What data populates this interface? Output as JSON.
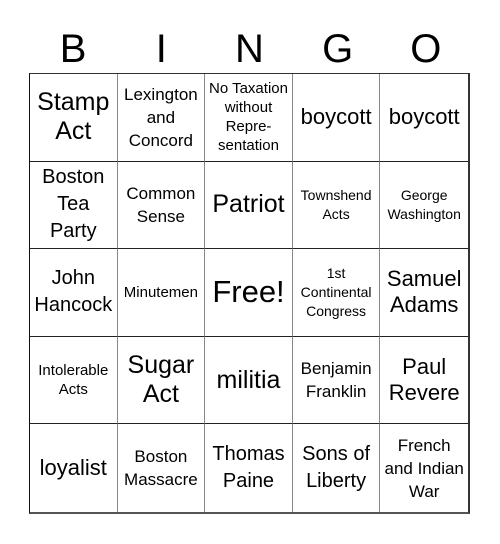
{
  "title_letters": [
    "B",
    "I",
    "N",
    "G",
    "O"
  ],
  "colors": {
    "text": "#000000",
    "background": "#ffffff",
    "grid_line": "#222222",
    "vertical_line": "#888888"
  },
  "cells": [
    {
      "text": "Stamp\nAct",
      "size": "s-l"
    },
    {
      "text": "Lexington\nand\nConcord",
      "size": "s-s"
    },
    {
      "text": "No Taxation\nwithout\nRepre-\nsentation",
      "size": "s-xs"
    },
    {
      "text": "boycott",
      "size": "s-ml"
    },
    {
      "text": "boycott",
      "size": "s-ml"
    },
    {
      "text": "Boston\nTea\nParty",
      "size": "s-m"
    },
    {
      "text": "Common\nSense",
      "size": "s-s"
    },
    {
      "text": "Patriot",
      "size": "s-l"
    },
    {
      "text": "Townshend\nActs",
      "size": "s-xxs"
    },
    {
      "text": "George\nWashington",
      "size": "s-xxs"
    },
    {
      "text": "John\nHancock",
      "size": "s-m"
    },
    {
      "text": "Minutemen",
      "size": "s-xs"
    },
    {
      "text": "Free!",
      "size": "s-xl"
    },
    {
      "text": "1st\nContinental\nCongress",
      "size": "s-xxs"
    },
    {
      "text": "Samuel\nAdams",
      "size": "s-ml"
    },
    {
      "text": "Intolerable\nActs",
      "size": "s-xs"
    },
    {
      "text": "Sugar\nAct",
      "size": "s-l"
    },
    {
      "text": "militia",
      "size": "s-l"
    },
    {
      "text": "Benjamin\nFranklin",
      "size": "s-s"
    },
    {
      "text": "Paul\nRevere",
      "size": "s-ml"
    },
    {
      "text": "loyalist",
      "size": "s-ml"
    },
    {
      "text": "Boston\nMassacre",
      "size": "s-s"
    },
    {
      "text": "Thomas\nPaine",
      "size": "s-m"
    },
    {
      "text": "Sons of\nLiberty",
      "size": "s-m"
    },
    {
      "text": "French\nand Indian\nWar",
      "size": "s-s"
    }
  ]
}
